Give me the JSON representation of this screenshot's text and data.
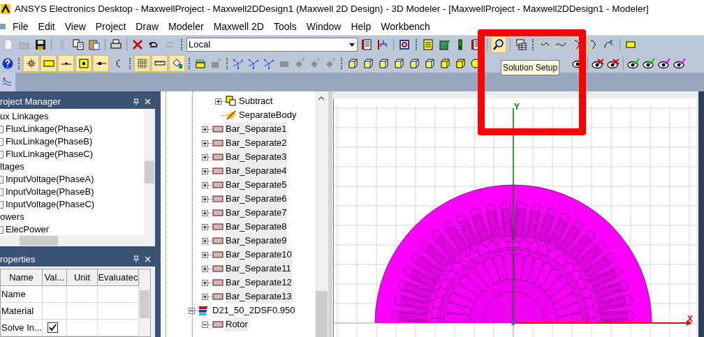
{
  "window": {
    "title": "ANSYS Electronics Desktop - MaxwellProject - Maxwell2DDesign1 (Maxwell 2D Design) - 3D Modeler - [MaxwellProject - Maxwell2DDesign1 - Modeler]"
  },
  "menu": [
    "File",
    "Edit",
    "View",
    "Project",
    "Draw",
    "Modeler",
    "Maxwell 2D",
    "Tools",
    "Window",
    "Help",
    "Workbench"
  ],
  "toolbar": {
    "coordinate_system": "Local",
    "tooltip": "Solution Setup",
    "snap_buttons": [
      {
        "on": true
      },
      {
        "on": true
      },
      {
        "on": true
      },
      {
        "on": true
      },
      {
        "on": true
      },
      {
        "on": false
      }
    ],
    "grid_buttons": [
      {
        "on": true
      },
      {
        "on": true
      },
      {
        "on": true
      }
    ]
  },
  "project_manager": {
    "title": "roject Manager",
    "items": [
      {
        "label": "ux Linkages",
        "children": [
          {
            "label": "FluxLinkage(PhaseA)"
          },
          {
            "label": "FluxLinkage(PhaseB)"
          },
          {
            "label": "FluxLinkage(PhaseC)"
          }
        ]
      },
      {
        "label": "ltages",
        "children": [
          {
            "label": "InputVoltage(PhaseA)"
          },
          {
            "label": "InputVoltage(PhaseB)"
          },
          {
            "label": "InputVoltage(PhaseC)"
          }
        ]
      },
      {
        "label": "owers",
        "children": [
          {
            "label": "ElecPower"
          }
        ]
      }
    ]
  },
  "properties": {
    "title": "roperties",
    "columns": [
      "Name",
      "Val...",
      "Unit",
      "Evaluatec"
    ],
    "rows": [
      {
        "kind": "text",
        "name": "Name"
      },
      {
        "kind": "text",
        "name": "Material"
      },
      {
        "kind": "checkbox",
        "name": "Solve In...",
        "checked": true
      }
    ]
  },
  "model_tree": [
    {
      "children": [
        {
          "children": [
            {
              "label": "Subtract",
              "kind": "subtract",
              "expanded": false,
              "selected": false
            },
            {
              "label": "SeparateBody",
              "kind": "separate",
              "selected": false
            }
          ]
        },
        {
          "label": "Bar_Separate1",
          "kind": "object",
          "expanded": false,
          "selected": true
        },
        {
          "label": "Bar_Separate2",
          "kind": "object",
          "expanded": false,
          "selected": true
        },
        {
          "label": "Bar_Separate3",
          "kind": "object",
          "expanded": false,
          "selected": true
        },
        {
          "label": "Bar_Separate4",
          "kind": "object",
          "expanded": false,
          "selected": true
        },
        {
          "label": "Bar_Separate5",
          "kind": "object",
          "expanded": false,
          "selected": true
        },
        {
          "label": "Bar_Separate6",
          "kind": "object",
          "expanded": false,
          "selected": true
        },
        {
          "label": "Bar_Separate7",
          "kind": "object",
          "expanded": false,
          "selected": true
        },
        {
          "label": "Bar_Separate8",
          "kind": "object",
          "expanded": false,
          "selected": true
        },
        {
          "label": "Bar_Separate9",
          "kind": "object",
          "expanded": false,
          "selected": true
        },
        {
          "label": "Bar_Separate10",
          "kind": "object",
          "expanded": false,
          "selected": true
        },
        {
          "label": "Bar_Separate11",
          "kind": "object",
          "expanded": false,
          "selected": true
        },
        {
          "label": "Bar_Separate12",
          "kind": "object",
          "expanded": false,
          "selected": true
        },
        {
          "label": "Bar_Separate13",
          "kind": "object",
          "expanded": false,
          "selected": true
        }
      ]
    },
    {
      "label": "D21_50_2DSF0.950",
      "kind": "material",
      "expanded": true,
      "selected": false,
      "children": [
        {
          "label": "Rotor",
          "kind": "object",
          "expanded": true,
          "selected": true
        }
      ]
    }
  ],
  "canvas": {
    "axis_labels": {
      "y": "Y",
      "x": "X"
    }
  }
}
